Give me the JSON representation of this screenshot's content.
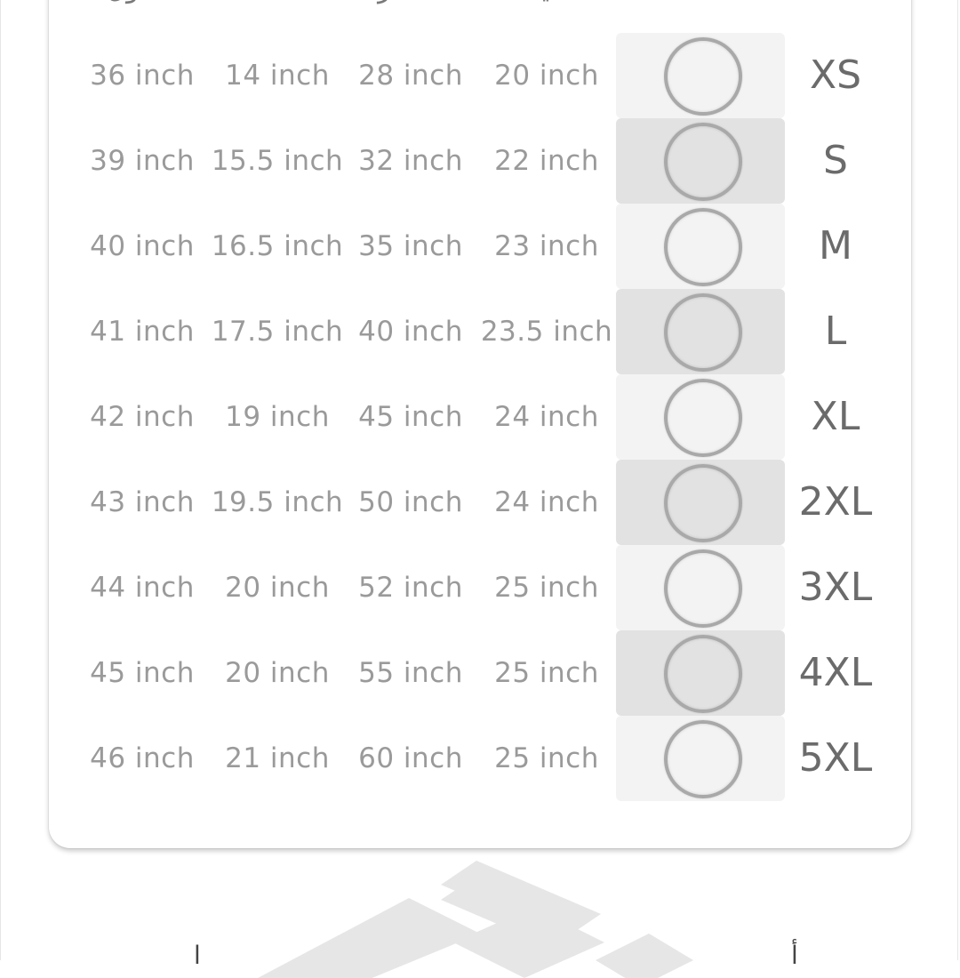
{
  "table": {
    "headers": [
      "الطول",
      "الكتف",
      "الصدر",
      "اليد"
    ],
    "rows": [
      {
        "length": "36 inch",
        "shoulder": "14 inch",
        "chest": "28 inch",
        "sleeve": "20 inch",
        "size": "XS"
      },
      {
        "length": "39 inch",
        "shoulder": "15.5 inch",
        "chest": "32 inch",
        "sleeve": "22 inch",
        "size": "S"
      },
      {
        "length": "40 inch",
        "shoulder": "16.5 inch",
        "chest": "35 inch",
        "sleeve": "23 inch",
        "size": "M"
      },
      {
        "length": "41 inch",
        "shoulder": "17.5 inch",
        "chest": "40 inch",
        "sleeve": "23.5 inch",
        "size": "L"
      },
      {
        "length": "42 inch",
        "shoulder": "19 inch",
        "chest": "45 inch",
        "sleeve": "24 inch",
        "size": "XL"
      },
      {
        "length": "43 inch",
        "shoulder": "19.5 inch",
        "chest": "50 inch",
        "sleeve": "24 inch",
        "size": "2XL"
      },
      {
        "length": "44 inch",
        "shoulder": "20 inch",
        "chest": "52 inch",
        "sleeve": "25 inch",
        "size": "3XL"
      },
      {
        "length": "45 inch",
        "shoulder": "20 inch",
        "chest": "55 inch",
        "sleeve": "25 inch",
        "size": "4XL"
      },
      {
        "length": "46 inch",
        "shoulder": "21 inch",
        "chest": "60 inch",
        "sleeve": "25 inch",
        "size": "5XL"
      }
    ]
  },
  "selected_size": null,
  "colors": {
    "value_text": "#9a9a9a",
    "size_text": "#6b6b6b",
    "radio_bg_light": "#f3f3f3",
    "radio_bg_dark": "#e2e2e2"
  },
  "icons": {
    "radio": "radio-circle-icon",
    "logo": "brand-logo-watermark"
  },
  "footer": {
    "left_text": "ا",
    "right_text": "أ"
  }
}
